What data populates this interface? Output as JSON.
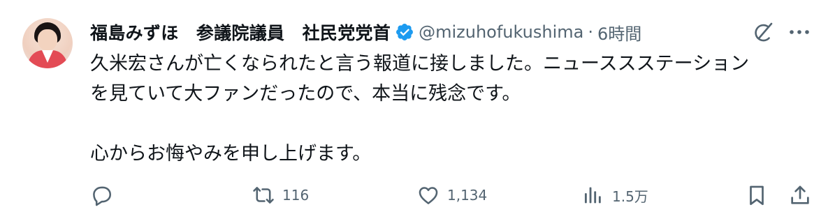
{
  "tweet": {
    "author_name": "福島みずほ　参議院議員　社民党党首",
    "handle": "@mizuhofukushima",
    "separator": "·",
    "time": "6時間",
    "paragraphs": [
      "久米宏さんが亡くなられたと言う報道に接しました。ニューススステーション",
      "を見ていて大ファンだったので、本当に残念です。",
      "心からお悔やみを申し上げます。"
    ]
  },
  "actions": {
    "reply_count": "",
    "retweet_count": "116",
    "like_count": "1,134",
    "views_count": "1.5万"
  },
  "icons": {
    "verified": "verified-badge-icon",
    "grok": "grok-icon",
    "more": "more-icon",
    "reply": "reply-icon",
    "retweet": "retweet-icon",
    "like": "like-icon",
    "views": "views-icon",
    "bookmark": "bookmark-icon",
    "share": "share-icon"
  },
  "colors": {
    "text": "#0f1419",
    "secondary": "#536471",
    "verified": "#1d9bf0"
  }
}
